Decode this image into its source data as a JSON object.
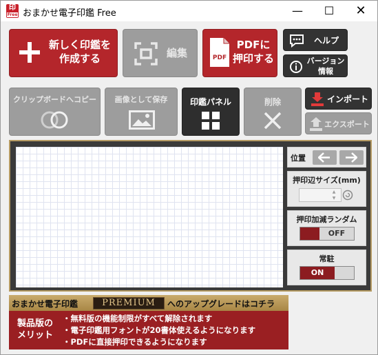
{
  "window": {
    "title": "おまかせ電子印鑑 Free",
    "icon_text": "印",
    "icon_sub": "Free",
    "min": "—",
    "max": "☐",
    "close": "✕"
  },
  "toolbar": {
    "create_label": "新しく印鑑を\n作成する",
    "edit_label": "編集",
    "pdf_icon_text": "PDF",
    "pdf_label": "PDFに\n押印する",
    "help_label": "ヘルプ",
    "version_label": "バージョン\n情報",
    "copy_label": "クリップボードへコピー",
    "save_image_label": "画像として保存",
    "panel_label": "印鑑パネル",
    "delete_label": "削除",
    "import_label": "インポート",
    "export_label": "エクスポート"
  },
  "side_panel": {
    "position_label": "位置",
    "size_label": "押印辺サイズ(mm)",
    "size_value": "",
    "random_label": "押印加減ランダム",
    "random_state": "OFF",
    "resident_label": "常駐",
    "resident_state": "ON"
  },
  "promo": {
    "prefix": "おまかせ電子印鑑",
    "badge": "PREMIUM",
    "suffix": "へのアップグレードはコチラ",
    "merit_title": "製品版の\nメリット",
    "bullets": [
      "・無料版の機能制限がすべて解除されます",
      "・電子印鑑用フォントが20書体使えるようになります",
      "・PDFに直接押印できるようになります"
    ]
  },
  "colors": {
    "accent_red": "#b4262b",
    "disabled_gray": "#9d9d9d",
    "dark_button": "#333333",
    "frame_gold": "#b59a62"
  }
}
